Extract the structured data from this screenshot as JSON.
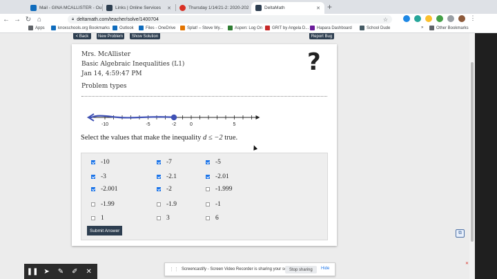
{
  "browser": {
    "tabs": [
      {
        "label": "Mail - GINA MCALLISTER - Ou",
        "color": "#0f6cbd"
      },
      {
        "label": "Links | Online Services",
        "color": "#2d3e50"
      },
      {
        "label": "Thursday 1/14/21-2: 2020-202",
        "color": "#d93025"
      },
      {
        "label": "DeltaMath",
        "color": "#2d3e50"
      }
    ],
    "new_tab": "+",
    "url": "deltamath.com/teacher/solve/1400704",
    "bookmarks": [
      {
        "label": "Apps",
        "color": "#5f6368"
      },
      {
        "label": "knoxschools.org Bookmarks",
        "color": "#0f6cbd"
      },
      {
        "label": "Outlook",
        "color": "#0f6cbd"
      },
      {
        "label": "Files - OneDrive",
        "color": "#0f6cbd"
      },
      {
        "label": "Splat! – Steve Wy...",
        "color": "#e37400"
      },
      {
        "label": "Aspen: Log On",
        "color": "#2e7d32"
      },
      {
        "label": "GRIT by Angela D...",
        "color": "#c62828"
      },
      {
        "label": "Hapara Dashboard",
        "color": "#6a1b9a"
      },
      {
        "label": "School Dude",
        "color": "#455a64"
      },
      {
        "label": "Other Bookmarks",
        "color": "#5f6368"
      }
    ],
    "more": "»"
  },
  "page_buttons": {
    "back": "< Back",
    "new_problem": "New Problem",
    "show_solution": "Show Solution",
    "report_bug": "Report Bug"
  },
  "problem": {
    "teacher": "Mrs. McAllister",
    "assignment": "Basic Algebraic Inequalities (L1)",
    "date": "Jan 14, 4:59:47 PM",
    "problem_types": "Problem types",
    "help_icon": "?",
    "number_line": {
      "ticks": [
        -10,
        -9,
        -8,
        -7,
        -6,
        -5,
        -4,
        -3,
        -2,
        -1,
        0,
        1,
        2,
        3,
        4,
        5,
        6,
        7
      ],
      "labels": [
        "-10",
        "-5",
        "-2",
        "0",
        "5"
      ],
      "label_values": [
        -10,
        -5,
        -2,
        0,
        5
      ],
      "endpoint": -2,
      "closed": true,
      "direction": "left",
      "shade_color": "#3f51b5"
    },
    "prompt_before": "Select the values that make the inequality",
    "prompt_math": "d ≤ −2",
    "prompt_after": "true.",
    "choices": [
      {
        "label": "-10",
        "checked": true
      },
      {
        "label": "-7",
        "checked": true
      },
      {
        "label": "-5",
        "checked": true
      },
      {
        "label": "-3",
        "checked": true
      },
      {
        "label": "-2.1",
        "checked": true
      },
      {
        "label": "-2.01",
        "checked": true
      },
      {
        "label": "-2.001",
        "checked": true
      },
      {
        "label": "-2",
        "checked": true
      },
      {
        "label": "-1.999",
        "checked": false
      },
      {
        "label": "-1.99",
        "checked": false
      },
      {
        "label": "-1.9",
        "checked": false
      },
      {
        "label": "-1",
        "checked": false
      },
      {
        "label": "1",
        "checked": false
      },
      {
        "label": "3",
        "checked": false
      },
      {
        "label": "6",
        "checked": false
      }
    ],
    "submit": "Submit Answer"
  },
  "screencastify": {
    "message": "Screencastify - Screen Video Recorder is sharing your screen.",
    "stop": "Stop sharing",
    "hide": "Hide"
  }
}
